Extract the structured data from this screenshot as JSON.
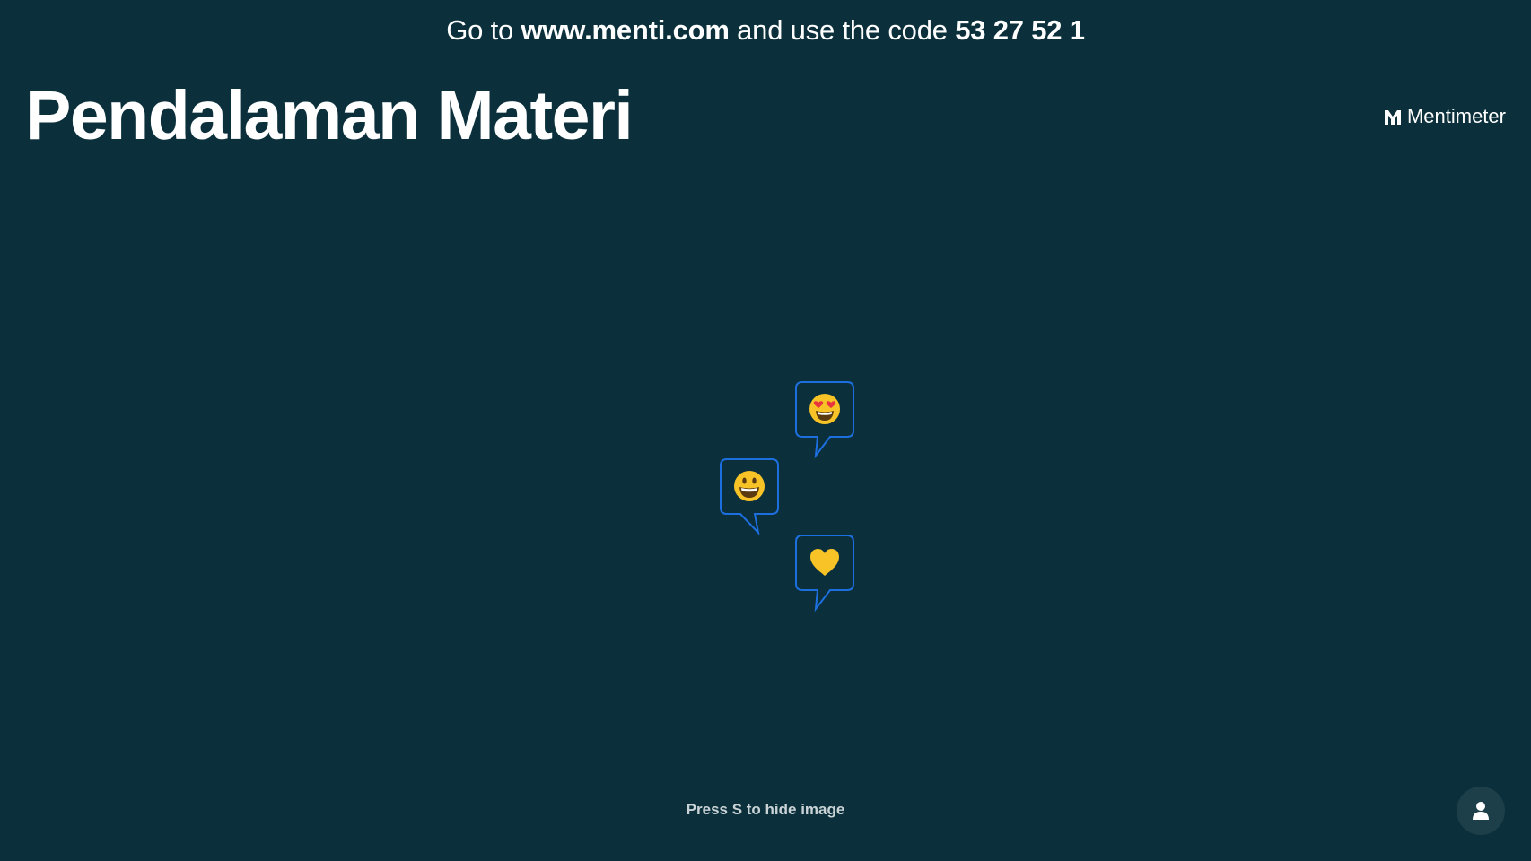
{
  "join": {
    "prefix": "Go to",
    "url": "www.menti.com",
    "middle": "and use the code",
    "code": "53 27 52 1"
  },
  "slide": {
    "title": "Pendalaman Materi"
  },
  "brand": {
    "name": "Mentimeter",
    "icon": "mentimeter-logo-icon"
  },
  "reactions": [
    {
      "emoji": "heart-eyes",
      "icon": "heart-eyes-emoji-icon"
    },
    {
      "emoji": "grinning",
      "icon": "grinning-emoji-icon"
    },
    {
      "emoji": "yellow-heart",
      "icon": "yellow-heart-icon"
    }
  ],
  "hint": {
    "text": "Press S to hide image"
  },
  "profile": {
    "icon": "user-icon"
  },
  "colors": {
    "background": "#0b303b",
    "bubble_border": "#1d6fe0",
    "emoji_yellow": "#f7c326",
    "heart_red": "#e8343f"
  }
}
